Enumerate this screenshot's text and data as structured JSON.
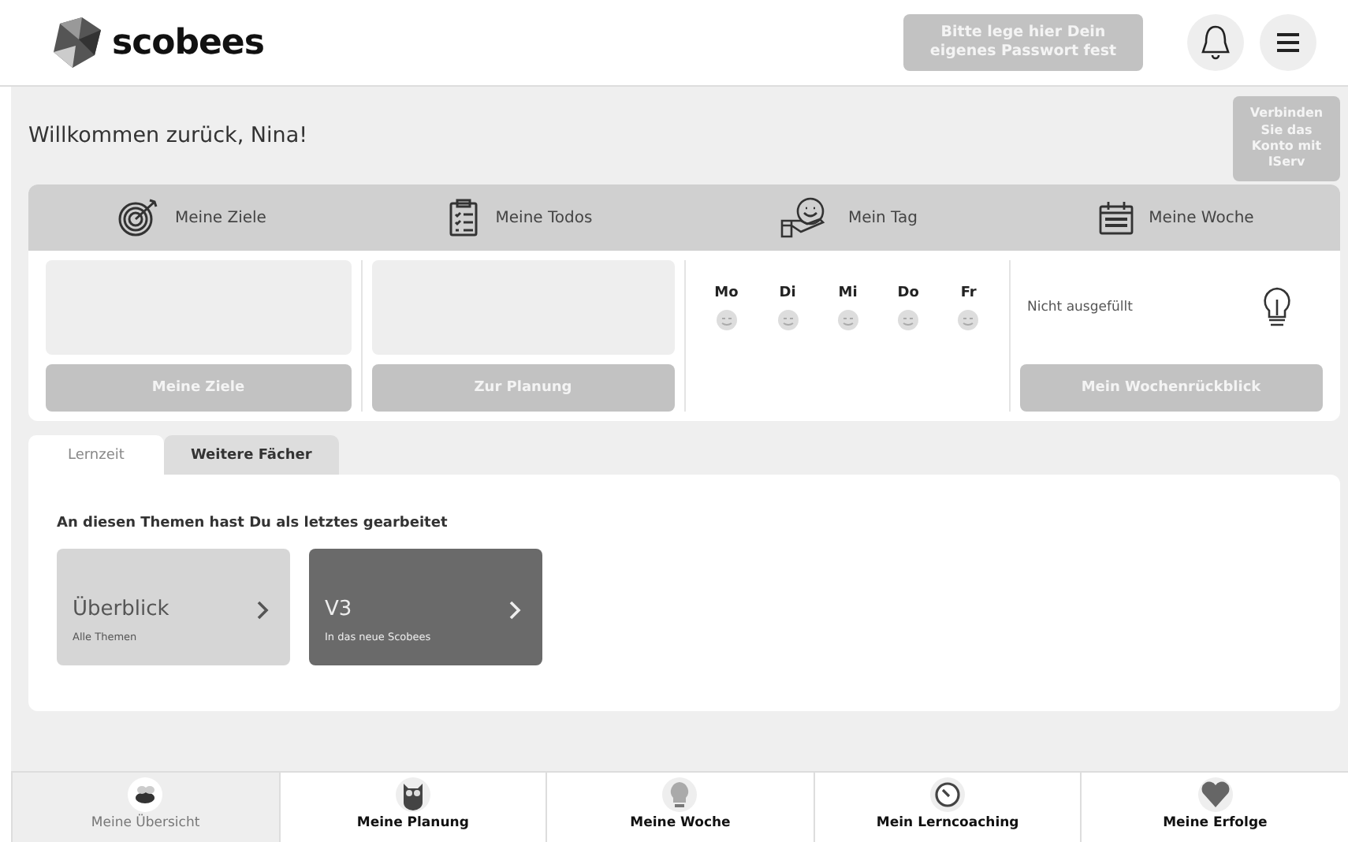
{
  "header": {
    "logo": "scobees",
    "password_button": "Bitte lege hier Dein eigenes Passwort fest"
  },
  "welcome": {
    "text": "Willkommen zurück, Nina!",
    "iserv_button": "Verbinden Sie das Konto mit IServ"
  },
  "dashboard": {
    "sections": [
      {
        "label": "Meine Ziele",
        "kind": "goals",
        "button": "Meine Ziele"
      },
      {
        "label": "Meine Todos",
        "kind": "todos",
        "button": "Zur Planung"
      },
      {
        "label": "Mein Tag",
        "kind": "day"
      },
      {
        "label": "Meine Woche",
        "kind": "week",
        "status": "Nicht ausgefüllt",
        "button": "Mein Wochenrückblick"
      }
    ],
    "days": [
      {
        "label": "Mo"
      },
      {
        "label": "Di"
      },
      {
        "label": "Mi"
      },
      {
        "label": "Do"
      },
      {
        "label": "Fr"
      }
    ]
  },
  "tabs": [
    {
      "label": "Lernzeit",
      "selected": true
    },
    {
      "label": "Weitere Fächer",
      "selected": false
    }
  ],
  "recent": {
    "heading": "An diesen Themen hast Du als letztes gearbeitet",
    "cards": [
      {
        "title": "Überblick",
        "subtitle": "Alle Themen",
        "kind": "light"
      },
      {
        "title": "V3",
        "subtitle": "In das neue Scobees",
        "kind": "dark"
      }
    ]
  },
  "nav": [
    {
      "label": "Meine Übersicht",
      "selected": true
    },
    {
      "label": "Meine Planung",
      "selected": false
    },
    {
      "label": "Meine Woche",
      "selected": false
    },
    {
      "label": "Mein Lerncoaching",
      "selected": false
    },
    {
      "label": "Meine Erfolge",
      "selected": false
    }
  ]
}
